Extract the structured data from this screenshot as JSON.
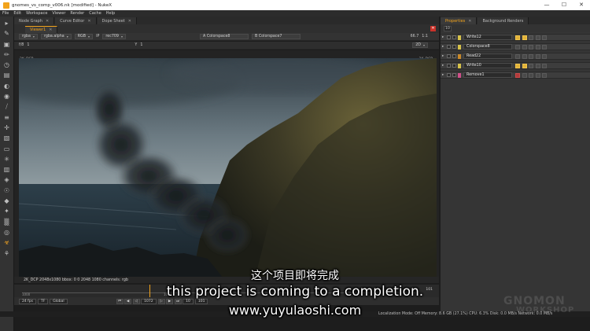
{
  "window": {
    "title": "gnomes_vs_comp_v006.nk [modified] - NukeX",
    "controls": [
      "—",
      "☐",
      "✕"
    ]
  },
  "menu": [
    "File",
    "Edit",
    "Workspace",
    "Viewer",
    "Render",
    "Cache",
    "Help"
  ],
  "left_tabs": [
    {
      "label": "Node Graph"
    },
    {
      "label": "Curve Editor"
    },
    {
      "label": "Dope Sheet"
    }
  ],
  "viewer_tab": {
    "label": "Viewer1"
  },
  "viewer_controls": {
    "channels": "rgba",
    "alpha": "rgba.alpha",
    "colorspace_mode": "RGB",
    "ip": "IP",
    "view_transform": "rec709",
    "input_a": "A  Colorspace8",
    "input_b": "B  Colorspace7",
    "zoom": "66.7",
    "ratio": "1:1",
    "view_mode": "2D",
    "gain_label": "f/8",
    "gain_value": "1",
    "gamma_label": "Y",
    "gamma_value": "1"
  },
  "format_label": "2K_DCP",
  "format_label_right": "2K_DCP",
  "info_bar": "2K_DCP 2048x1080  bbox: 0 0 2048 1080 channels: rgb",
  "timeline": {
    "start": "1000",
    "end": "1020",
    "current_frame": "1001",
    "last_frame": "101"
  },
  "transport": {
    "fps": "24 fps",
    "tf": "TF",
    "scope": "Global",
    "frame_field": "1072",
    "step": "10",
    "end_field": "101"
  },
  "properties_tabs": [
    {
      "label": "Properties"
    },
    {
      "label": "Background Renders"
    }
  ],
  "properties_max": "10",
  "nodes": [
    {
      "name": "Write12",
      "color": "#d7c24a",
      "highlight": true
    },
    {
      "name": "Colorspace8",
      "color": "#d7c24a",
      "highlight": false
    },
    {
      "name": "Read22",
      "color": "#c98a2a",
      "highlight": false
    },
    {
      "name": "Write10",
      "color": "#d7c24a",
      "highlight": true
    },
    {
      "name": "Remove1",
      "color": "#d0508a",
      "highlight": false
    }
  ],
  "status_bar": "Localization Mode: Off  Memory: 8.6 GB (27.1%)  CPU: 6.3%  Disk: 0.0 MB/s  Network: 0.0 MB/s",
  "watermark": {
    "line1": "GNOMON",
    "line2": "WORKSHOP"
  },
  "subtitles": {
    "chinese": "这个项目即将完成",
    "english": "this project is coming to a completion.",
    "url": "www.yuyulaoshi.com"
  },
  "icons": {
    "tools": [
      "pointer-icon",
      "pen-icon",
      "image-icon",
      "draw-icon",
      "time-icon",
      "channel-icon",
      "color-icon",
      "filter-icon",
      "keyer-icon",
      "merge-icon",
      "transform-icon",
      "3d-icon",
      "viewer-icon",
      "particles-icon",
      "deep-icon",
      "views-icon",
      "metadata-icon",
      "toolsets-icon",
      "other-icon",
      "furnace-icon",
      "cara-icon",
      "nuke-icon",
      "air-icon"
    ]
  }
}
